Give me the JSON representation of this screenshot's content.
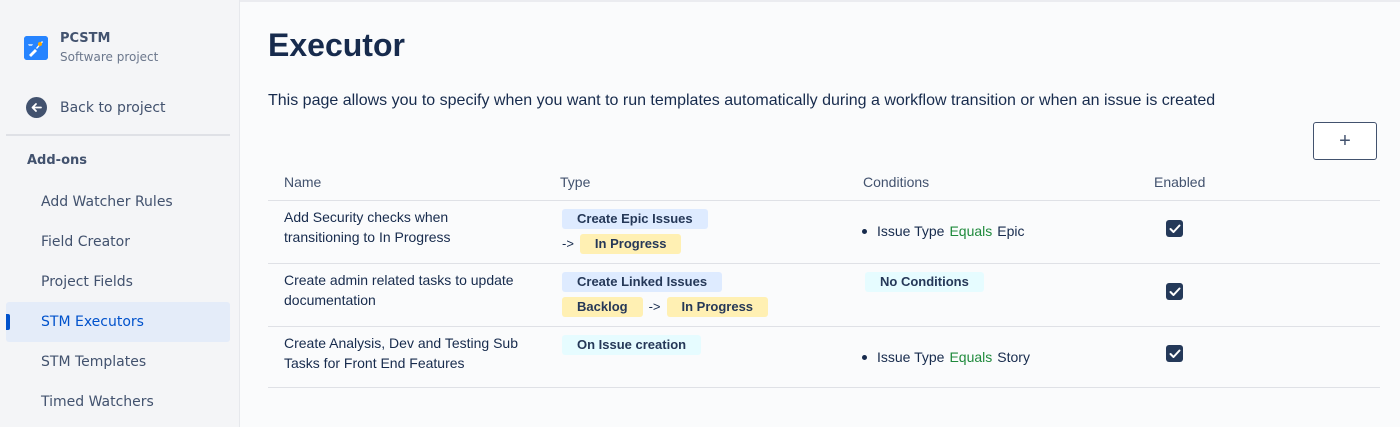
{
  "sidebar": {
    "project_name": "PCSTM",
    "project_type": "Software project",
    "back_label": "Back to project",
    "section_title": "Add-ons",
    "items": [
      {
        "label": "Add Watcher Rules"
      },
      {
        "label": "Field Creator"
      },
      {
        "label": "Project Fields"
      },
      {
        "label": "STM Executors",
        "active": true
      },
      {
        "label": "STM Templates"
      },
      {
        "label": "Timed Watchers"
      }
    ]
  },
  "main": {
    "title": "Executor",
    "description": "This page allows you to specify when you want to run templates automatically during a workflow transition or when an issue is created",
    "add_button": "+"
  },
  "table": {
    "headers": {
      "name": "Name",
      "type": "Type",
      "conditions": "Conditions",
      "enabled": "Enabled"
    },
    "rows": [
      {
        "name_line1": "Add Security checks when",
        "name_line2": "transitioning to In Progress",
        "type_action": "Create Epic Issues",
        "arrow": "->",
        "to_status": "In Progress",
        "cond_field": "Issue Type",
        "cond_op": "Equals",
        "cond_value": "Epic",
        "enabled": true
      },
      {
        "name_line1": "Create admin related tasks to update",
        "name_line2": "documentation",
        "type_action": "Create Linked Issues",
        "from_status": "Backlog",
        "arrow": "->",
        "to_status": "In Progress",
        "no_conditions": "No Conditions",
        "enabled": true
      },
      {
        "name_line1": "Create Analysis, Dev and Testing Sub",
        "name_line2": "Tasks for Front End Features",
        "type_action": "On Issue creation",
        "cond_field": "Issue Type",
        "cond_op": "Equals",
        "cond_value": "Story",
        "enabled": true
      }
    ]
  },
  "colors": {
    "accent": "#0052cc",
    "equals": "#1f8a3c",
    "lozenge_blue": "#deebff",
    "lozenge_yellow": "#fff0b3",
    "lozenge_teal": "#e6fcff",
    "checkbox": "#243959"
  }
}
